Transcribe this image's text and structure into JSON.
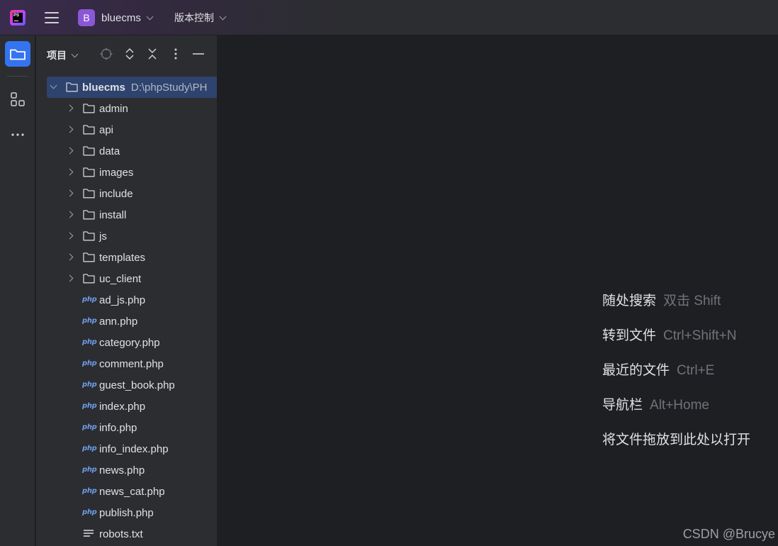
{
  "titlebar": {
    "app_logo_text": "PS",
    "project_badge": "B",
    "project_name": "bluecms",
    "vcs_label": "版本控制"
  },
  "toolstrip": {
    "items": [
      {
        "name": "project",
        "icon": "folder-icon",
        "active": true
      },
      {
        "name": "structure",
        "icon": "structure-icon",
        "active": false
      },
      {
        "name": "more",
        "icon": "more-horizontal-icon",
        "active": false
      }
    ]
  },
  "panel": {
    "title": "项目",
    "toolbar_icons": [
      "locate-icon",
      "expand-all-icon",
      "collapse-all-icon",
      "more-vertical-icon",
      "minimize-icon"
    ],
    "root": {
      "name": "bluecms",
      "path": "D:\\phpStudy\\PH"
    },
    "items": [
      {
        "type": "folder",
        "name": "admin"
      },
      {
        "type": "folder",
        "name": "api"
      },
      {
        "type": "folder",
        "name": "data"
      },
      {
        "type": "folder",
        "name": "images"
      },
      {
        "type": "folder",
        "name": "include"
      },
      {
        "type": "folder",
        "name": "install"
      },
      {
        "type": "folder",
        "name": "js"
      },
      {
        "type": "folder",
        "name": "templates"
      },
      {
        "type": "folder",
        "name": "uc_client"
      },
      {
        "type": "php",
        "name": "ad_js.php"
      },
      {
        "type": "php",
        "name": "ann.php"
      },
      {
        "type": "php",
        "name": "category.php"
      },
      {
        "type": "php",
        "name": "comment.php"
      },
      {
        "type": "php",
        "name": "guest_book.php"
      },
      {
        "type": "php",
        "name": "index.php"
      },
      {
        "type": "php",
        "name": "info.php"
      },
      {
        "type": "php",
        "name": "info_index.php"
      },
      {
        "type": "php",
        "name": "news.php"
      },
      {
        "type": "php",
        "name": "news_cat.php"
      },
      {
        "type": "php",
        "name": "publish.php"
      },
      {
        "type": "txt",
        "name": "robots.txt"
      }
    ],
    "php_icon_text": "php"
  },
  "editor": {
    "hints": [
      {
        "action": "随处搜索",
        "shortcut": "双击 Shift"
      },
      {
        "action": "转到文件",
        "shortcut": "Ctrl+Shift+N"
      },
      {
        "action": "最近的文件",
        "shortcut": "Ctrl+E"
      },
      {
        "action": "导航栏",
        "shortcut": "Alt+Home"
      },
      {
        "action": "将文件拖放到此处以打开",
        "shortcut": ""
      }
    ],
    "watermark": "CSDN @Brucye"
  },
  "colors": {
    "accent": "#3574f0",
    "selection": "#2e436e",
    "project_badge": "#8a58d6",
    "php_icon": "#6e9be8",
    "shortcut_text": "#6f737a"
  }
}
